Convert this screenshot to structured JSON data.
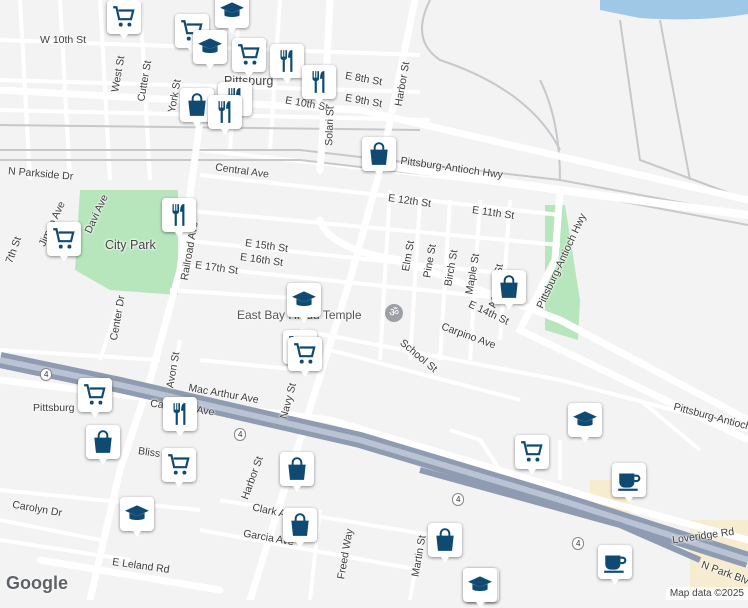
{
  "streets": [
    "W 10th St",
    "E 8th St",
    "E 9th St",
    "E 10th St",
    "West St",
    "Cutter St",
    "York St",
    "Solari St",
    "Harbor St",
    "Central Ave",
    "N Parkside Dr",
    "Pittsburg-Antioch Hwy",
    "E 12th St",
    "E 11th St",
    "Jimno Ave",
    "Davi Ave",
    "Railroad Ave",
    "E 15th St",
    "E 16th St",
    "E 17th St",
    "Elm St",
    "Pine St",
    "Birch St",
    "Maple St",
    "Acacia St",
    "E 14th St",
    "Pittsburg-Antioch Hwy",
    "Carpino Ave",
    "School St",
    "Center Dr",
    "Avon St",
    "Mac Arthur Ave",
    "California Ave",
    "Navy St",
    "Bliss Ave",
    "Carolyn Dr",
    "Clark Ave",
    "Garcia Ave",
    "Freed Way",
    "Martin St",
    "E Leland Rd",
    "Loveridge Rd",
    "N Park Blvd",
    "Pittsburg-Antioch Hwy",
    "7th St",
    "Harbor St"
  ],
  "places": {
    "city_park": "City Park",
    "temple": "East Bay Hindu Temple",
    "pittsburg": "Pittsburg",
    "pittsburg_center": "Pittsburg Center"
  },
  "route_shield": "4",
  "map_brand": "Google",
  "attribution": "Map data ©2025",
  "colors": {
    "background": "#f3f3f4",
    "road": "#ffffff",
    "highway": "#8e9bb0",
    "park": "#b7e6bd",
    "rail": "#c8c8cc",
    "pin_icon": "#0f4a73",
    "sand": "#f6eccf",
    "water": "#9fc7e6"
  },
  "pins": [
    {
      "kind": "shopping-cart"
    },
    {
      "kind": "graduation-cap"
    },
    {
      "kind": "shopping-cart"
    },
    {
      "kind": "graduation-cap"
    },
    {
      "kind": "shopping-cart"
    },
    {
      "kind": "restaurant"
    },
    {
      "kind": "restaurant"
    },
    {
      "kind": "shopping-bag"
    },
    {
      "kind": "restaurant"
    },
    {
      "kind": "restaurant"
    },
    {
      "kind": "shopping-bag"
    },
    {
      "kind": "restaurant"
    },
    {
      "kind": "shopping-cart"
    },
    {
      "kind": "graduation-cap"
    },
    {
      "kind": "shopping-bag"
    },
    {
      "kind": "shopping-cart"
    },
    {
      "kind": "shopping-cart"
    },
    {
      "kind": "restaurant"
    },
    {
      "kind": "shopping-bag"
    },
    {
      "kind": "shopping-cart"
    },
    {
      "kind": "shopping-bag"
    },
    {
      "kind": "shopping-cart"
    },
    {
      "kind": "graduation-cap"
    },
    {
      "kind": "shopping-bag"
    },
    {
      "kind": "shopping-bag"
    },
    {
      "kind": "graduation-cap"
    },
    {
      "kind": "shopping-cart"
    },
    {
      "kind": "coffee"
    },
    {
      "kind": "shopping-bag"
    },
    {
      "kind": "coffee"
    },
    {
      "kind": "graduation-cap"
    }
  ]
}
